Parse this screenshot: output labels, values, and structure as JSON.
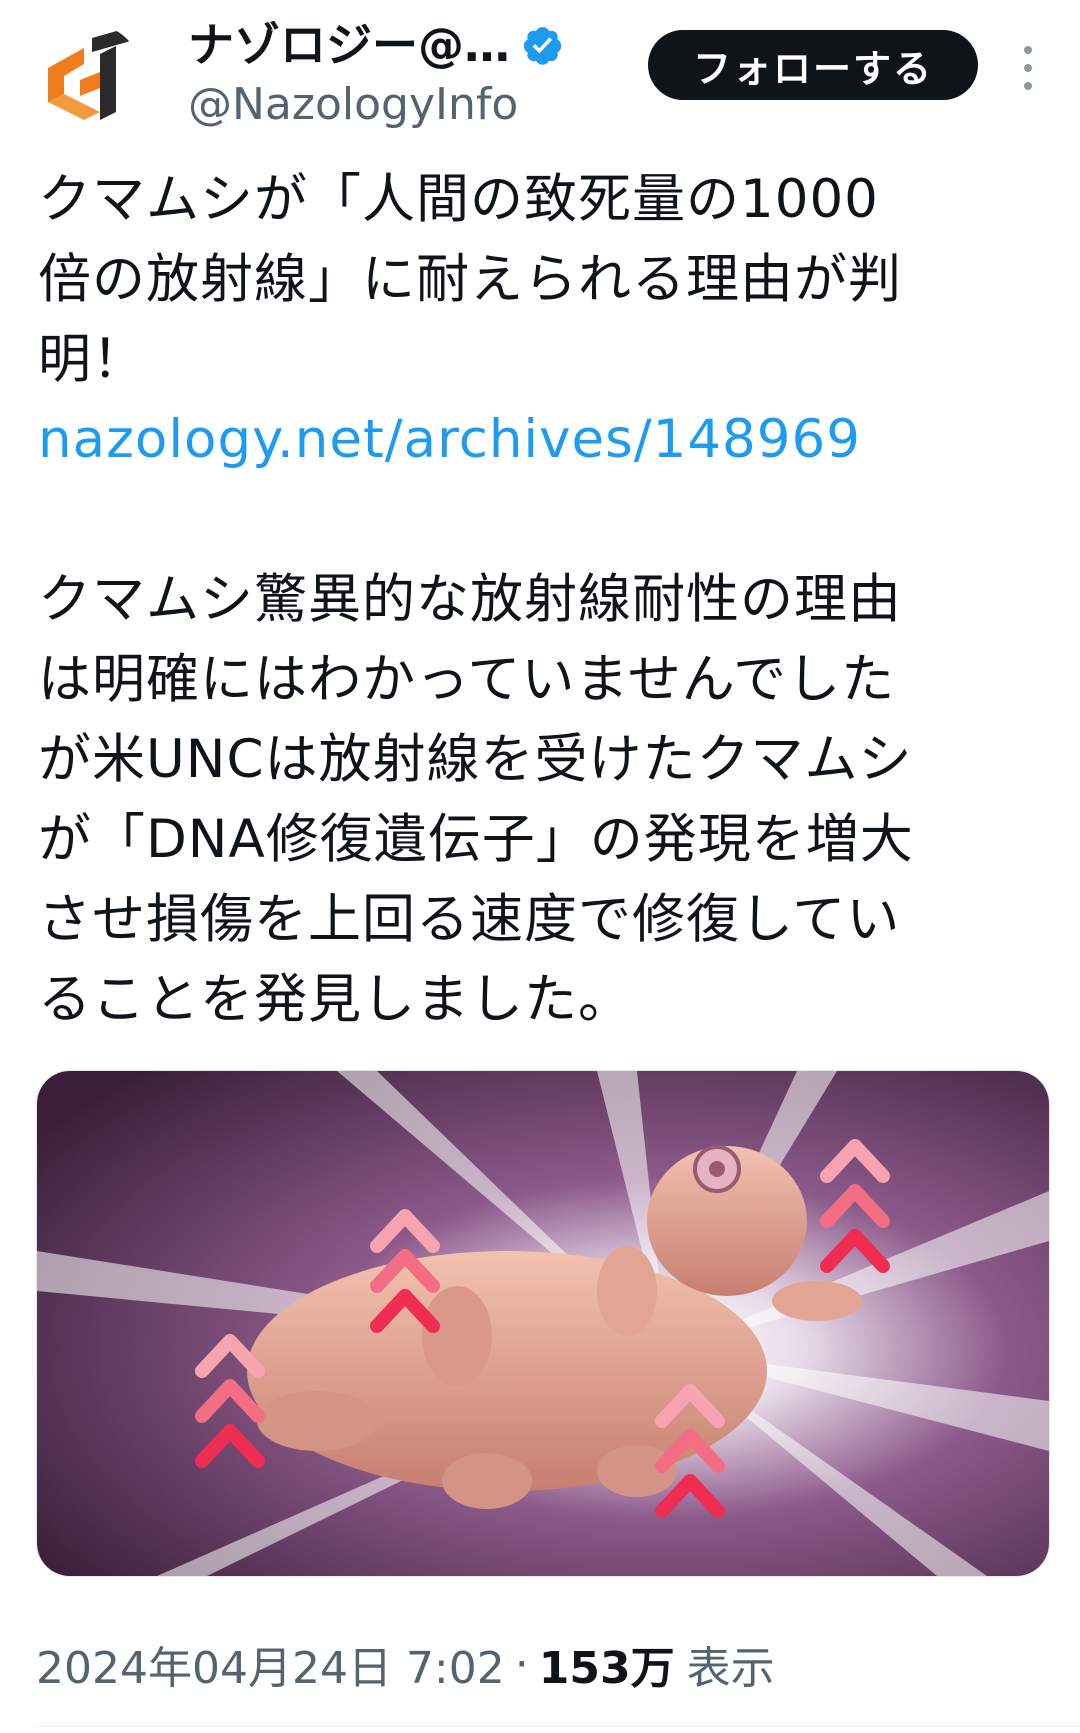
{
  "header": {
    "display_name": "ナゾロジー@…",
    "handle": "@NazologyInfo",
    "follow_label": "フォローする",
    "avatar_icon": "nazology-logo-icon",
    "verified_icon": "verified-badge-icon",
    "more_icon": "more-vertical-icon"
  },
  "tweet": {
    "line1": "クマムシが「人間の致死量の1000",
    "line2": "倍の放射線」に耐えられる理由が判",
    "line3": "明！",
    "link": "nazology.net/archives/148969",
    "para2_line1": "クマムシ驚異的な放射線耐性の理由",
    "para2_line2": "は明確にはわかっていませんでした",
    "para2_line3": "が米UNCは放射線を受けたクマムシ",
    "para2_line4": "が「DNA修復遺伝子」の発現を増大",
    "para2_line5": "させ損傷を上回る速度で修復してい",
    "para2_line6": "ることを発見しました。"
  },
  "media": {
    "subject": "tardigrade-illustration",
    "arrow_icon": "chevron-up-arrows-icon"
  },
  "meta": {
    "timestamp": "2024年04月24日 7:02",
    "separator": "·",
    "views_count": "153万",
    "views_label": "表示"
  },
  "colors": {
    "accent": "#1d9bf0",
    "follow_bg": "#0f1419",
    "secondary_text": "#536471",
    "brand_orange": "#f07d1c"
  }
}
